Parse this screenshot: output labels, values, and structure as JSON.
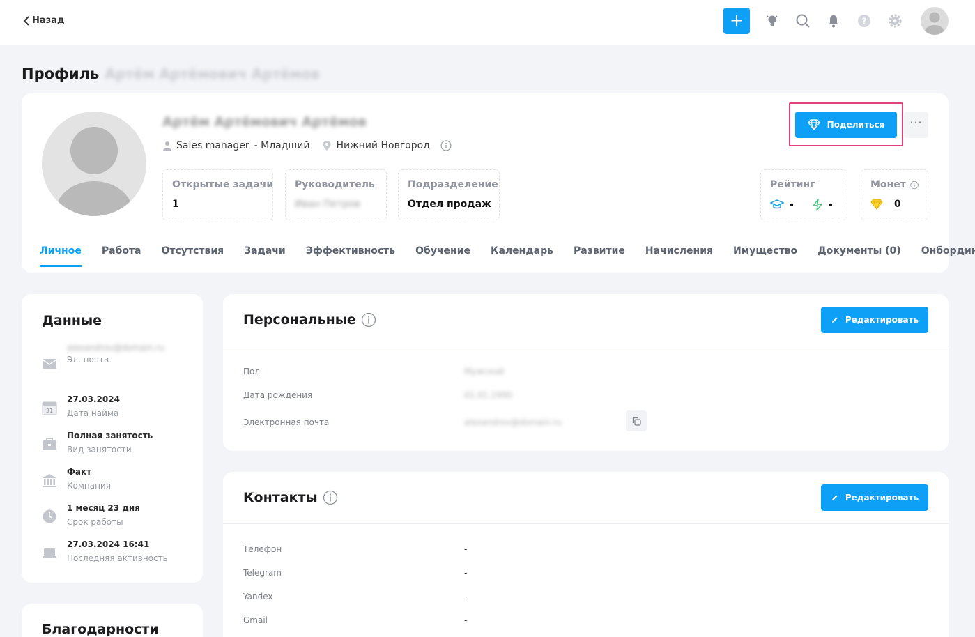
{
  "topbar": {
    "back_label": "Назад",
    "icons": [
      "plus-icon",
      "lightbulb-icon",
      "search-icon",
      "bell-icon",
      "help-icon",
      "gear-icon",
      "avatar"
    ]
  },
  "page": {
    "title": "Профиль",
    "title_name_blurred": "Артём Артёмович Артёмов"
  },
  "profile": {
    "name_blurred": "Артём Артёмович Артёмов",
    "position": "Sales manager",
    "grade": "- Младший",
    "city": "Нижний Новгород",
    "share_label": "Поделиться",
    "more_label": "···",
    "stats": [
      {
        "label": "Открытые задачи",
        "value": "1"
      },
      {
        "label": "Руководитель",
        "value_blurred": "Иван Петров"
      },
      {
        "label": "Подразделение",
        "value": "Отдел продаж"
      }
    ],
    "rating": {
      "label": "Рейтинг",
      "edu_value": "-",
      "power_value": "-"
    },
    "coins": {
      "label": "Монет",
      "value": "0"
    }
  },
  "tabs": [
    {
      "label": "Личное",
      "active": true
    },
    {
      "label": "Работа"
    },
    {
      "label": "Отсутствия"
    },
    {
      "label": "Задачи"
    },
    {
      "label": "Эффективность"
    },
    {
      "label": "Обучение"
    },
    {
      "label": "Календарь"
    },
    {
      "label": "Развитие"
    },
    {
      "label": "Начисления"
    },
    {
      "label": "Имущество"
    },
    {
      "label": "Документы (0)"
    },
    {
      "label": "Онбординг"
    }
  ],
  "data_card": {
    "title": "Данные",
    "email_blurred": "alexandrov@domain.ru",
    "email_label": "Эл. почта",
    "hire_date": "27.03.2024",
    "hire_label": "Дата найма",
    "employment": "Полная занятость",
    "employment_label": "Вид занятости",
    "company": "Факт",
    "company_label": "Компания",
    "tenure": "1 месяц 23 дня",
    "tenure_label": "Срок работы",
    "last_activity": "27.03.2024 16:41",
    "last_activity_label": "Последняя активность"
  },
  "thanks_card": {
    "title": "Благодарности"
  },
  "personal": {
    "title": "Персональные",
    "edit_label": "Редактировать",
    "fields": [
      {
        "label": "Пол",
        "value_blurred": "Мужской"
      },
      {
        "label": "Дата рождения",
        "value_blurred": "01.01.1990"
      },
      {
        "label": "Электронная почта",
        "value_blurred": "alexandrov@domain.ru"
      }
    ]
  },
  "contacts": {
    "title": "Контакты",
    "edit_label": "Редактировать",
    "fields": [
      {
        "label": "Телефон",
        "value": "-"
      },
      {
        "label": "Telegram",
        "value": "-"
      },
      {
        "label": "Yandex",
        "value": "-"
      },
      {
        "label": "Gmail",
        "value": "-"
      }
    ]
  },
  "colors": {
    "accent": "#0ea0f6",
    "highlight": "#e0417d",
    "background": "#f2f4f7"
  }
}
